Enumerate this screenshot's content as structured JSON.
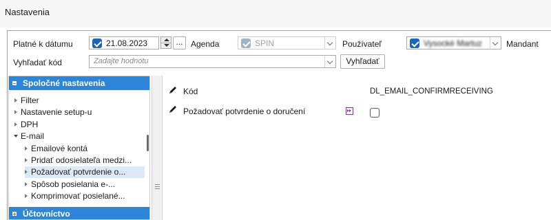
{
  "window": {
    "title": "Nastavenia"
  },
  "filters": {
    "date_label": "Platné k dátumu",
    "date_value": "21.08.2023",
    "ellipsis": "...",
    "agenda_label": "Agenda",
    "agenda_value": "SPIN",
    "user_label": "Používateľ",
    "user_value": "Vysocké Martuz",
    "mandant_label": "Mandant",
    "search_label": "Vyhľadať kód",
    "search_placeholder": "Zadajte hodnotu",
    "search_button": "Vyhľadať"
  },
  "tree": {
    "group1": "Spoločné nastavenia",
    "group2": "Účtovníctvo",
    "nodes": [
      "Filter",
      "Nastavenie setup-u",
      "DPH",
      "E-mail"
    ],
    "email_children": [
      "Emailové kontá",
      "Pridať odosielateľa medzi...",
      "Požadovať potvrdenie o...",
      "Spôsob posielania e-...",
      "Komprimovať posielané..."
    ]
  },
  "detail": {
    "code_label": "Kód",
    "code_value": "DL_EMAIL_CONFIRMRECEIVING",
    "setting_label": "Požadovať potvrdenie o doručení",
    "setting_checked": false
  },
  "colors": {
    "accent": "#2e84d6",
    "checkbox": "#1f63b4",
    "selection": "#dceaf7"
  }
}
